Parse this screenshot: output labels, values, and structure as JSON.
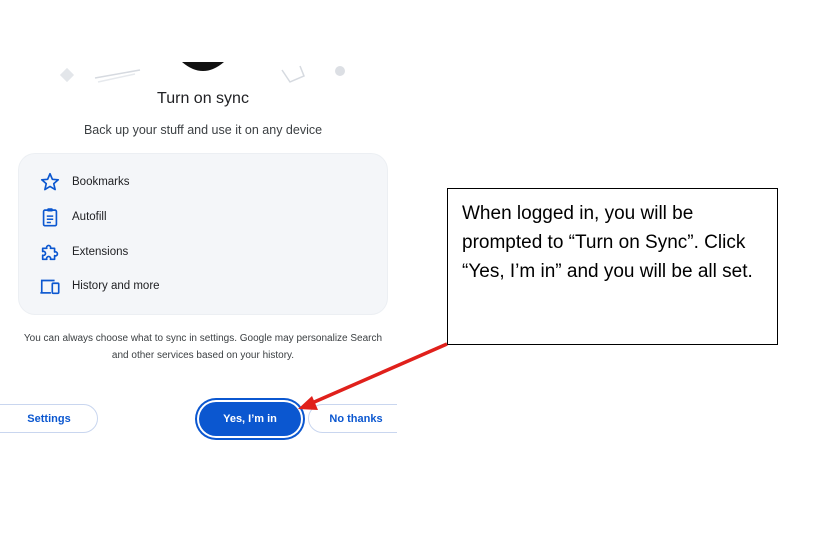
{
  "sync_dialog": {
    "title": "Turn on sync",
    "subtitle": "Back up your stuff and use it on any device",
    "features": [
      {
        "label": "Bookmarks",
        "icon": "star-icon"
      },
      {
        "label": "Autofill",
        "icon": "clipboard-icon"
      },
      {
        "label": "Extensions",
        "icon": "puzzle-icon"
      },
      {
        "label": "History and more",
        "icon": "devices-icon"
      }
    ],
    "disclaimer": "You can always choose what to sync in settings. Google may personalize Search and other services based on your history.",
    "buttons": {
      "settings": "Settings",
      "yes": "Yes, I’m in",
      "no": "No thanks"
    }
  },
  "callout": {
    "text": "When logged in, you will be prompted to “Turn on Sync”. Click “Yes, I’m in” and you will be all set."
  },
  "colors": {
    "accent": "#0b57d0",
    "arrow": "#e0201b",
    "card_bg": "#f4f6f9"
  }
}
